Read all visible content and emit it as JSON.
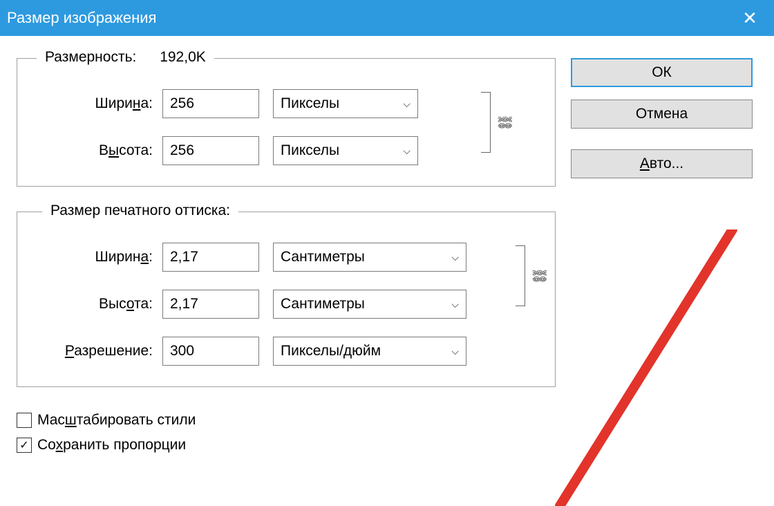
{
  "title": "Размер изображения",
  "group_dimensions": {
    "legend": "Размерность:",
    "value": "192,0K",
    "width_label_pre": "Шири",
    "width_label_u": "н",
    "width_label_post": "а:",
    "width_value": "256",
    "width_unit": "Пикселы",
    "height_label_pre": "В",
    "height_label_u": "ы",
    "height_label_post": "сота:",
    "height_value": "256",
    "height_unit": "Пикселы"
  },
  "group_print": {
    "legend": "Размер печатного оттиска:",
    "width_label_pre": "Ширин",
    "width_label_u": "а",
    "width_label_post": ":",
    "width_value": "2,17",
    "width_unit": "Сантиметры",
    "height_label_pre": "Выс",
    "height_label_u": "о",
    "height_label_post": "та:",
    "height_value": "2,17",
    "height_unit": "Сантиметры",
    "res_label_u": "Р",
    "res_label_post": "азрешение:",
    "res_value": "300",
    "res_unit": "Пикселы/дюйм"
  },
  "checkboxes": {
    "scale_styles_pre": "Мас",
    "scale_styles_u": "ш",
    "scale_styles_post": "табировать стили",
    "scale_styles_checked": false,
    "constrain_pre": "Со",
    "constrain_u": "х",
    "constrain_post": "ранить пропорции",
    "constrain_checked": true
  },
  "buttons": {
    "ok": "ОК",
    "cancel": "Отмена",
    "auto_u": "А",
    "auto_post": "вто..."
  }
}
